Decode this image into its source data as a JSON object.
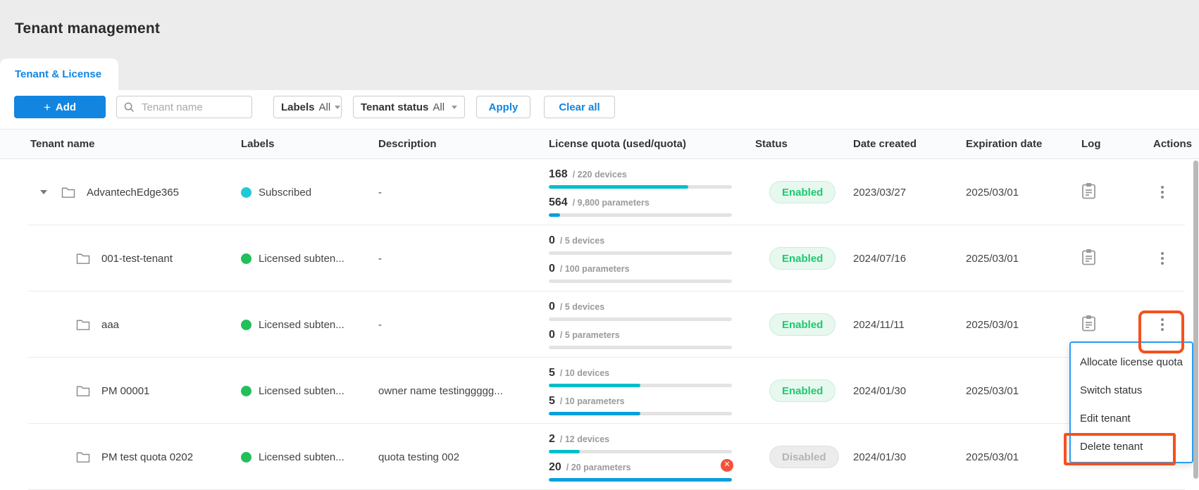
{
  "page": {
    "title": "Tenant management"
  },
  "tabs": {
    "active": "Tenant & License"
  },
  "toolbar": {
    "add_icon": "+",
    "add_button": "Add",
    "search_placeholder": "Tenant name",
    "labels_filter_label": "Labels",
    "labels_filter_value": "All",
    "status_filter_label": "Tenant status",
    "status_filter_value": "All",
    "apply_button": "Apply",
    "clear_button": "Clear all"
  },
  "table": {
    "columns": [
      "Tenant name",
      "Labels",
      "Description",
      "License quota (used/quota)",
      "Status",
      "Date created",
      "Expiration date",
      "Log",
      "Actions"
    ],
    "rows": [
      {
        "name": "AdvantechEdge365",
        "expandable": true,
        "label": {
          "text": "Subscribed",
          "color": "#1ecbd6"
        },
        "description": "-",
        "devices": {
          "used": "168",
          "rest": "/ 220 devices",
          "pct": 76
        },
        "parameters": {
          "used": "564",
          "rest": "/ 9,800 parameters",
          "pct": 6
        },
        "status": "Enabled",
        "date_created": "2023/03/27",
        "expiration_date": "2025/03/01"
      },
      {
        "name": "001-test-tenant",
        "label": {
          "text": "Licensed subten...",
          "color": "#21c05a"
        },
        "description": "-",
        "devices": {
          "used": "0",
          "rest": "/ 5 devices",
          "pct": 0
        },
        "parameters": {
          "used": "0",
          "rest": "/ 100 parameters",
          "pct": 0
        },
        "status": "Enabled",
        "date_created": "2024/07/16",
        "expiration_date": "2025/03/01"
      },
      {
        "name": "aaa",
        "label": {
          "text": "Licensed subten...",
          "color": "#21c05a"
        },
        "description": "-",
        "devices": {
          "used": "0",
          "rest": "/ 5 devices",
          "pct": 0
        },
        "parameters": {
          "used": "0",
          "rest": "/ 5 parameters",
          "pct": 0
        },
        "status": "Enabled",
        "date_created": "2024/11/11",
        "expiration_date": "2025/03/01"
      },
      {
        "name": "PM 00001",
        "label": {
          "text": "Licensed subten...",
          "color": "#21c05a"
        },
        "description": "owner name testinggggg...",
        "devices": {
          "used": "5",
          "rest": "/ 10 devices",
          "pct": 50
        },
        "parameters": {
          "used": "5",
          "rest": "/ 10 parameters",
          "pct": 50
        },
        "status": "Enabled",
        "date_created": "2024/01/30",
        "expiration_date": "2025/03/01"
      },
      {
        "name": "PM test quota 0202",
        "label": {
          "text": "Licensed subten...",
          "color": "#21c05a"
        },
        "description": "quota testing 002",
        "devices": {
          "used": "2",
          "rest": "/ 12 devices",
          "pct": 17
        },
        "parameters": {
          "used": "20",
          "rest": "/ 20 parameters",
          "pct": 100,
          "error": true
        },
        "status": "Disabled",
        "date_created": "2024/01/30",
        "expiration_date": "2025/03/01"
      }
    ]
  },
  "actions_menu": {
    "items": [
      "Allocate license quota",
      "Switch status",
      "Edit tenant",
      "Delete tenant"
    ]
  },
  "icons": {
    "error_glyph": "✕",
    "search": "magnifier",
    "folder": "folder-outline",
    "log": "clipboard",
    "actions": "kebab-vertical",
    "expand": "caret-down"
  },
  "colors": {
    "accent_blue": "#1285e0",
    "devices_bar": "#00bfc9",
    "parameters_bar": "#0aa0dc",
    "label_green": "#21c05a",
    "label_cyan": "#1ecbd6",
    "enabled_green": "#1ec96e",
    "disabled_gray": "#b5b5b5",
    "annotation_red": "#f4511e",
    "menu_border_blue": "#2b9cf2"
  }
}
